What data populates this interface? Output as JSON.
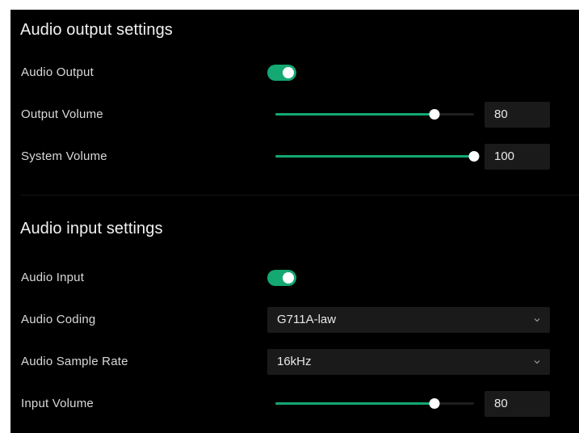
{
  "output_section": {
    "title": "Audio output settings",
    "audio_output": {
      "label": "Audio Output",
      "enabled": true
    },
    "output_volume": {
      "label": "Output Volume",
      "value": "80",
      "level": 80
    },
    "system_volume": {
      "label": "System Volume",
      "value": "100",
      "level": 100
    }
  },
  "input_section": {
    "title": "Audio input settings",
    "audio_input": {
      "label": "Audio Input",
      "enabled": true
    },
    "audio_coding": {
      "label": "Audio Coding",
      "selected": "G711A-law"
    },
    "sample_rate": {
      "label": "Audio Sample Rate",
      "selected": "16kHz"
    },
    "input_volume": {
      "label": "Input Volume",
      "value": "80",
      "level": 80
    }
  },
  "colors": {
    "accent": "#14a872",
    "background": "#000000",
    "field_background": "#1a1a1a"
  },
  "icons": {
    "dropdown": "chevron-down-icon"
  }
}
